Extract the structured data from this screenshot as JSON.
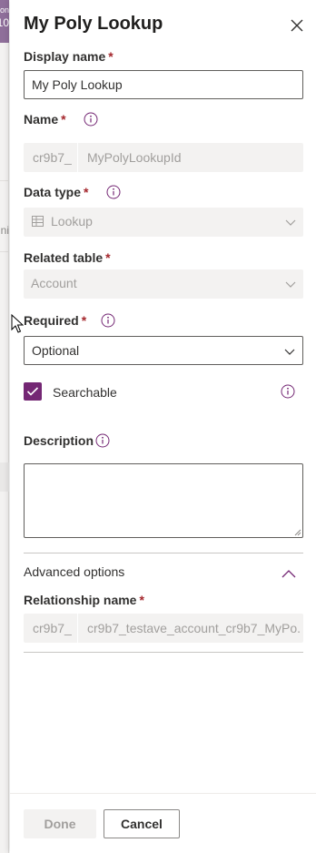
{
  "panel": {
    "title": "My Poly Lookup"
  },
  "display_name": {
    "label": "Display name",
    "required": "*",
    "value": "My Poly Lookup"
  },
  "name": {
    "label": "Name",
    "required": "*",
    "prefix": "cr9b7_",
    "value": "MyPolyLookupId"
  },
  "data_type": {
    "label": "Data type",
    "required": "*",
    "value": "Lookup",
    "icon": "lookup-table-icon"
  },
  "related_table": {
    "label": "Related table",
    "required": "*",
    "value": "Account"
  },
  "required_field": {
    "label": "Required",
    "required": "*",
    "value": "Optional"
  },
  "searchable": {
    "label": "Searchable",
    "checked": true
  },
  "description": {
    "label": "Description",
    "value": ""
  },
  "advanced": {
    "label": "Advanced options",
    "expanded": true
  },
  "relationship_name": {
    "label": "Relationship name",
    "required": "*",
    "prefix": "cr9b7_",
    "value": "cr9b7_testave_account_cr9b7_MyPo..."
  },
  "footer": {
    "done_label": "Done",
    "cancel_label": "Cancel"
  },
  "background": {
    "top_text_1": "on",
    "top_text_2": "10",
    "mid_text": "ni"
  },
  "colors": {
    "accent": "#742774",
    "required": "#a4262c",
    "disabled_bg": "#f3f2f1",
    "info_icon": "#742774"
  }
}
